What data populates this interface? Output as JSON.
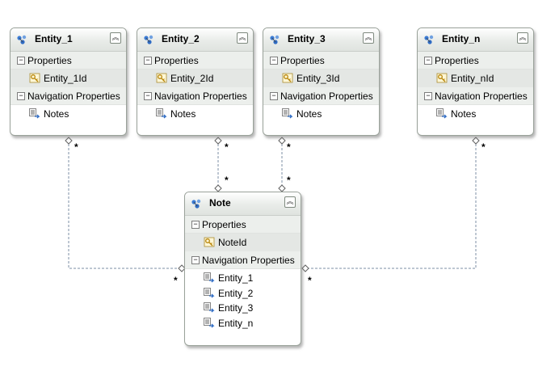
{
  "entities": [
    {
      "title": "Entity_1",
      "properties_label": "Properties",
      "key_property": "Entity_1Id",
      "nav_label": "Navigation Properties",
      "nav": [
        "Notes"
      ]
    },
    {
      "title": "Entity_2",
      "properties_label": "Properties",
      "key_property": "Entity_2Id",
      "nav_label": "Navigation Properties",
      "nav": [
        "Notes"
      ]
    },
    {
      "title": "Entity_3",
      "properties_label": "Properties",
      "key_property": "Entity_3Id",
      "nav_label": "Navigation Properties",
      "nav": [
        "Notes"
      ]
    },
    {
      "title": "Entity_n",
      "properties_label": "Properties",
      "key_property": "Entity_nId",
      "nav_label": "Navigation Properties",
      "nav": [
        "Notes"
      ]
    }
  ],
  "note": {
    "title": "Note",
    "properties_label": "Properties",
    "key_property": "NoteId",
    "nav_label": "Navigation Properties",
    "nav": [
      "Entity_1",
      "Entity_2",
      "Entity_3",
      "Entity_n"
    ]
  },
  "multiplicity": "*",
  "colors": {
    "border": "#9aa29a",
    "header": "#e9ece9",
    "section": "#ecefec",
    "connector": "#7d8fa5"
  }
}
